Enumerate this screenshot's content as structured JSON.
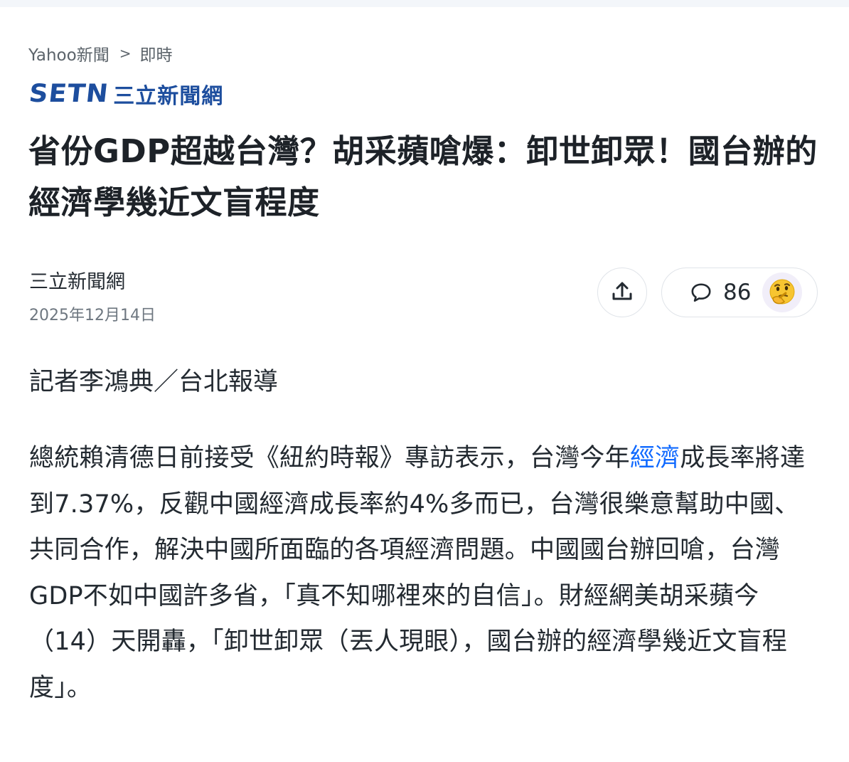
{
  "breadcrumb": {
    "site": "Yahoo新聞",
    "separator": ">",
    "section": "即時"
  },
  "logo": {
    "latin": "SETN",
    "cjk": "三立新聞網",
    "color": "#1d4e9e"
  },
  "headline": "省份GDP超越台灣？胡采蘋嗆爆：卸世卸眾！國台辦的經濟學幾近文盲程度",
  "meta": {
    "author": "三立新聞網",
    "date": "2025年12月14日"
  },
  "actions": {
    "share_icon": "share-upload-icon",
    "comment_icon": "speech-bubble-icon",
    "comment_count": "86",
    "reaction_icon": "thinking-face-emoji"
  },
  "article": {
    "byline": "記者李鴻典／台北報導",
    "paragraph_before_link": "總統賴清德日前接受《紐約時報》專訪表示，台灣今年",
    "link_text": "經濟",
    "paragraph_after_link": "成長率將達到7.37%，反觀中國經濟成長率約4%多而已，台灣很樂意幫助中國、共同合作，解決中國所面臨的各項經濟問題。中國國台辦回嗆，台灣GDP不如中國許多省，「真不知哪裡來的自信」。財經網美胡采蘋今（14）天開轟，「卸世卸眾（丟人現眼），國台辦的經濟學幾近文盲程度」。",
    "link_color": "#0f69ff"
  }
}
